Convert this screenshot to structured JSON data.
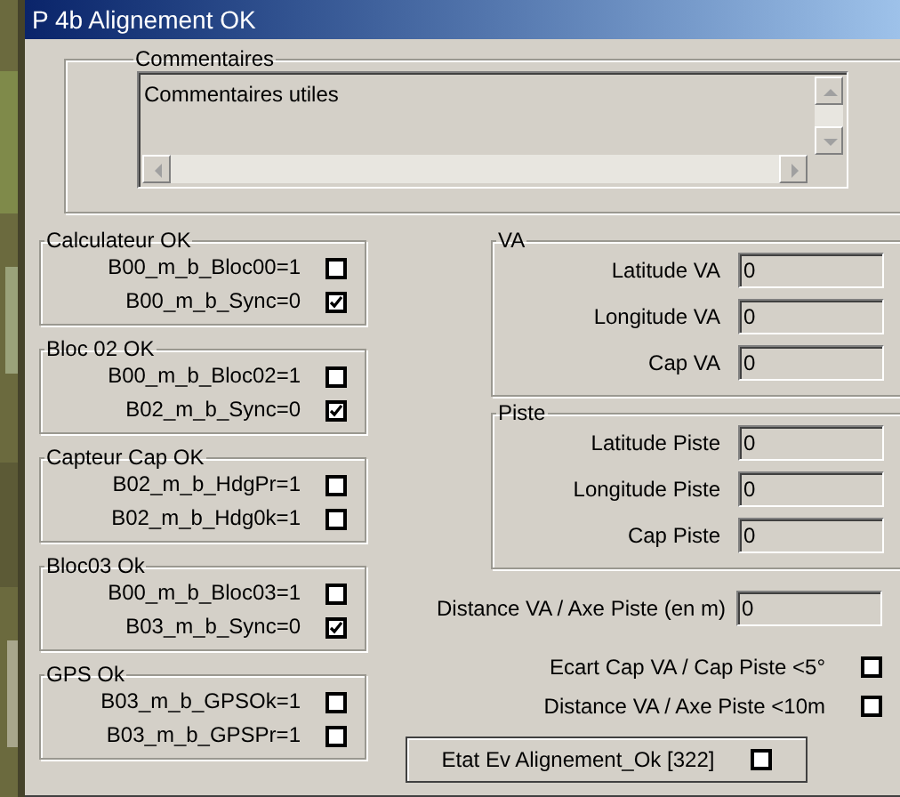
{
  "window": {
    "title": "P 4b Alignement OK"
  },
  "comments": {
    "label": "Commentaires",
    "text": "Commentaires utiles"
  },
  "groups": [
    {
      "title": "Calculateur OK",
      "rows": [
        {
          "label": "B00_m_b_Bloc00=1",
          "checked": false
        },
        {
          "label": "B00_m_b_Sync=0",
          "checked": true
        }
      ]
    },
    {
      "title": "Bloc 02 OK",
      "rows": [
        {
          "label": "B00_m_b_Bloc02=1",
          "checked": false
        },
        {
          "label": "B02_m_b_Sync=0",
          "checked": true
        }
      ]
    },
    {
      "title": "Capteur Cap OK",
      "rows": [
        {
          "label": "B02_m_b_HdgPr=1",
          "checked": false
        },
        {
          "label": "B02_m_b_Hdg0k=1",
          "checked": false
        }
      ]
    },
    {
      "title": "Bloc03 Ok",
      "rows": [
        {
          "label": "B00_m_b_Bloc03=1",
          "checked": false
        },
        {
          "label": "B03_m_b_Sync=0",
          "checked": true
        }
      ]
    },
    {
      "title": "GPS Ok",
      "rows": [
        {
          "label": "B03_m_b_GPSOk=1",
          "checked": false
        },
        {
          "label": "B03_m_b_GPSPr=1",
          "checked": false
        }
      ]
    }
  ],
  "positions": [
    {
      "title": "VA",
      "fields": [
        {
          "label": "Latitude VA",
          "value": "0"
        },
        {
          "label": "Longitude VA",
          "value": "0"
        },
        {
          "label": "Cap VA",
          "value": "0"
        }
      ]
    },
    {
      "title": "Piste",
      "fields": [
        {
          "label": "Latitude Piste",
          "value": "0"
        },
        {
          "label": "Longitude Piste",
          "value": "0"
        },
        {
          "label": "Cap Piste",
          "value": "0"
        }
      ]
    }
  ],
  "distance": {
    "label": "Distance VA / Axe Piste (en m)",
    "value": "0"
  },
  "checks": [
    {
      "label": "Ecart Cap VA / Cap Piste <5°",
      "checked": false
    },
    {
      "label": "Distance VA / Axe Piste <10m",
      "checked": false
    }
  ],
  "status": {
    "label": "Etat Ev Alignement_Ok [322]",
    "checked": false
  }
}
